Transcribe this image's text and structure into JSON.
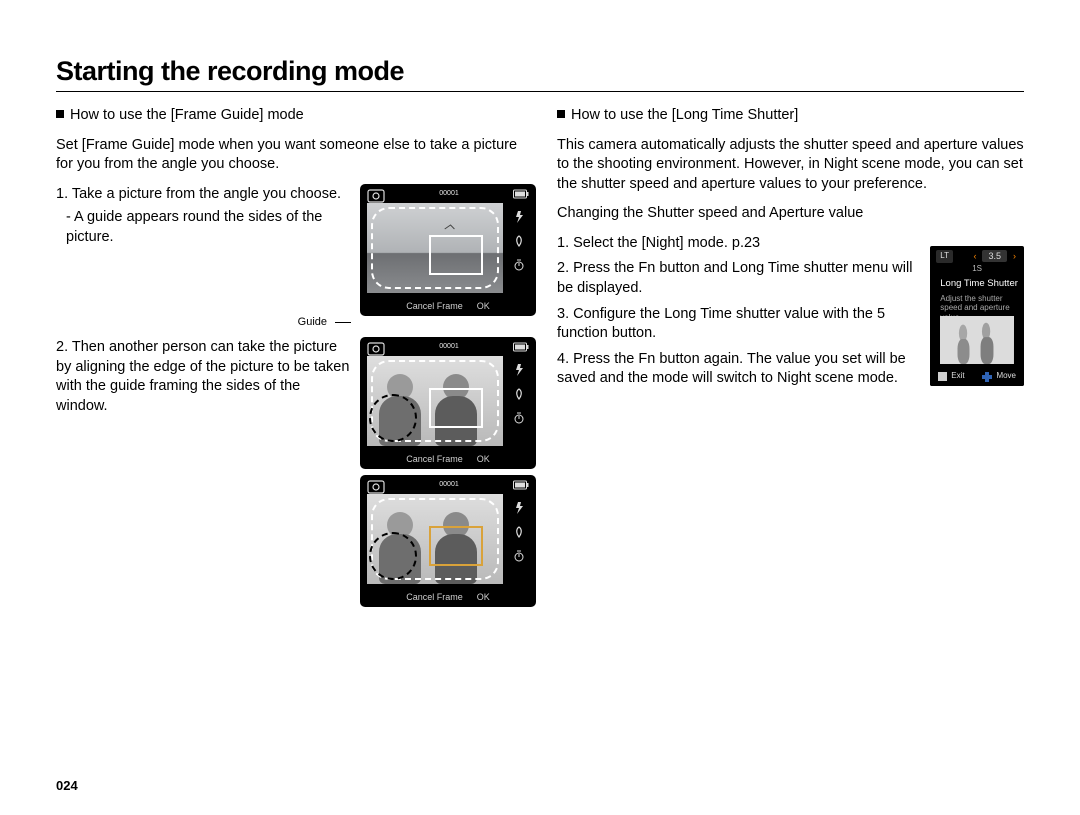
{
  "page_title": "Starting the recording mode",
  "page_number": "024",
  "left": {
    "subhead": "How to use the [Frame Guide] mode",
    "intro": "Set [Frame Guide] mode when you want someone else to take a picture for you from the angle you choose.",
    "step1": "1. Take a picture from the angle you choose.",
    "step1_sub": "- A guide appears round the sides of the picture.",
    "guide_label": "Guide",
    "step2": "2. Then another person can take the picture by aligning the edge of the picture to be taken with the guide framing the sides of the window.",
    "lcd": {
      "counter": "00001",
      "cancel": "Cancel Frame",
      "ok": "OK"
    }
  },
  "right": {
    "subhead": "How to use the [Long Time Shutter]",
    "intro": "This camera automatically adjusts the shutter speed and aperture values to the shooting environment. However, in Night scene mode, you can set the shutter speed and aperture values to your preference.",
    "changing": "Changing the Shutter speed and Aperture value",
    "step1": "1.  Select the [Night] mode.  p.23",
    "step2": "2. Press the Fn button and Long Time shutter menu will be displayed.",
    "step3": "3. Configure the Long Time shutter value with the 5 function button.",
    "step4": "4. Press the Fn button again. The value you set will be saved and the mode will switch to Night scene mode.",
    "lcd": {
      "tag": "LT",
      "value": "3.5",
      "sub_value": "1S",
      "label": "Long Time Shutter",
      "desc": "Adjust the shutter speed and aperture value.",
      "exit": "Exit",
      "move": "Move"
    }
  }
}
